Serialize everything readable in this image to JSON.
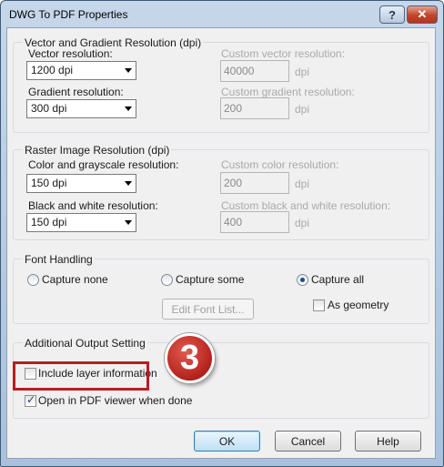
{
  "window": {
    "title": "DWG To PDF Properties",
    "help_glyph": "?",
    "close_glyph": "✕"
  },
  "vector_group": {
    "legend": "Vector and Gradient Resolution (dpi)",
    "vector_label": "Vector resolution:",
    "vector_value": "1200 dpi",
    "custom_vector_label": "Custom vector resolution:",
    "custom_vector_value": "40000",
    "custom_vector_unit": "dpi",
    "gradient_label": "Gradient resolution:",
    "gradient_value": "300 dpi",
    "custom_gradient_label": "Custom gradient resolution:",
    "custom_gradient_value": "200",
    "custom_gradient_unit": "dpi"
  },
  "raster_group": {
    "legend": "Raster Image Resolution (dpi)",
    "color_label": "Color and grayscale resolution:",
    "color_value": "150 dpi",
    "custom_color_label": "Custom color resolution:",
    "custom_color_value": "200",
    "custom_color_unit": "dpi",
    "bw_label": "Black and white resolution:",
    "bw_value": "150 dpi",
    "custom_bw_label": "Custom black and white resolution:",
    "custom_bw_value": "400",
    "custom_bw_unit": "dpi"
  },
  "font_group": {
    "legend": "Font Handling",
    "capture_none": "Capture none",
    "capture_some": "Capture some",
    "capture_all": "Capture all",
    "selected": "Capture all",
    "edit_font_list": "Edit Font List...",
    "as_geometry": "As geometry",
    "as_geometry_checked": false
  },
  "output_group": {
    "legend": "Additional Output Setting",
    "include_layer": "Include layer information",
    "include_layer_checked": false,
    "open_viewer": "Open in PDF viewer when done",
    "open_viewer_checked": true
  },
  "annotation": {
    "step_number": "3",
    "highlight_color": "#b22020"
  },
  "buttons": {
    "ok": "OK",
    "cancel": "Cancel",
    "help": "Help"
  }
}
